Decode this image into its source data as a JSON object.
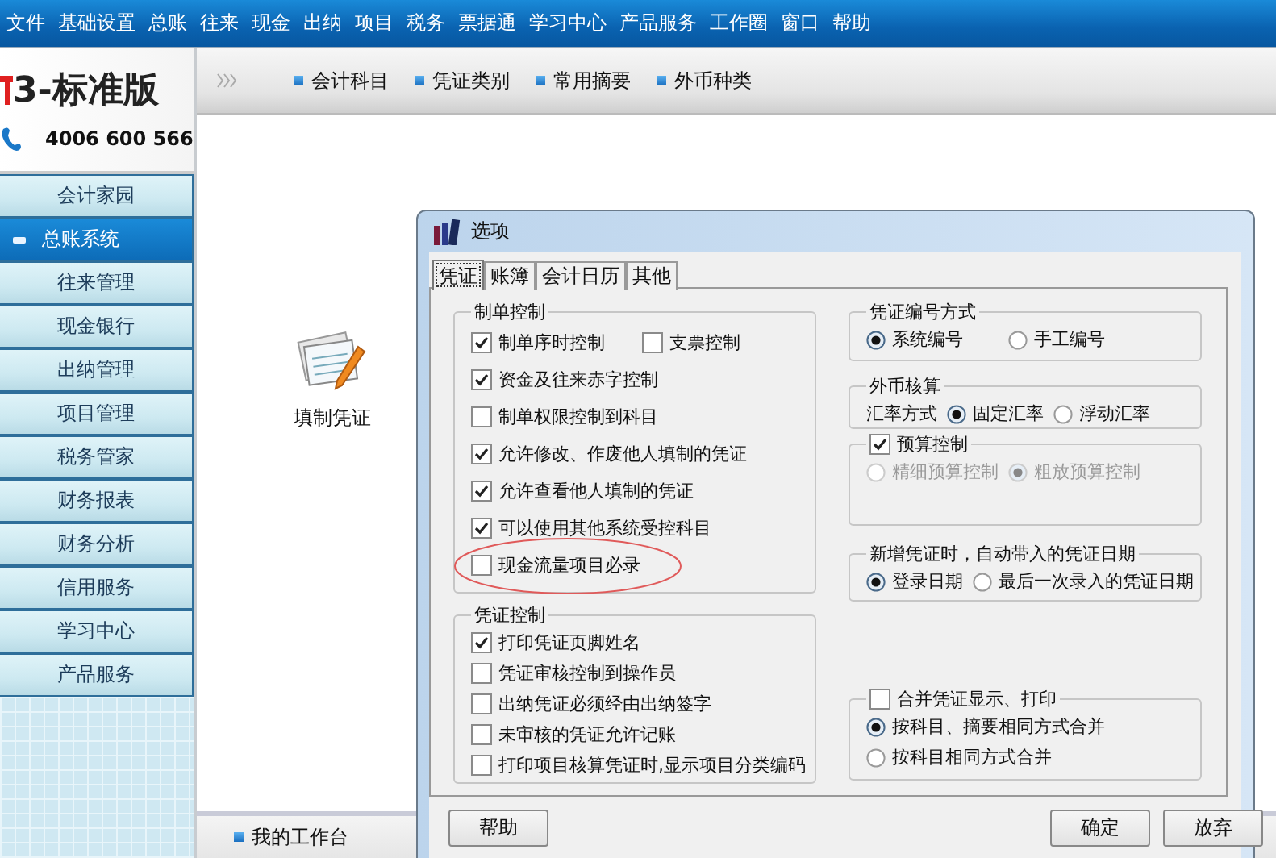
{
  "menu_bar": [
    "文件",
    "基础设置",
    "总账",
    "往来",
    "现金",
    "出纳",
    "项目",
    "税务",
    "票据通",
    "学习中心",
    "产品服务",
    "工作圈",
    "窗口",
    "帮助"
  ],
  "logo": {
    "title": "3-标准版",
    "phone": "4006 600 566"
  },
  "sidebar": {
    "items": [
      {
        "label": "会计家园",
        "selected": false
      },
      {
        "label": "总账系统",
        "selected": true
      },
      {
        "label": "往来管理",
        "selected": false
      },
      {
        "label": "现金银行",
        "selected": false
      },
      {
        "label": "出纳管理",
        "selected": false
      },
      {
        "label": "项目管理",
        "selected": false
      },
      {
        "label": "税务管家",
        "selected": false
      },
      {
        "label": "财务报表",
        "selected": false
      },
      {
        "label": "财务分析",
        "selected": false
      },
      {
        "label": "信用服务",
        "selected": false
      },
      {
        "label": "学习中心",
        "selected": false
      },
      {
        "label": "产品服务",
        "selected": false
      }
    ]
  },
  "toolbar": {
    "links": [
      "会计科目",
      "凭证类别",
      "常用摘要",
      "外币种类"
    ]
  },
  "desktop": {
    "icons": [
      {
        "label": "填制凭证"
      }
    ]
  },
  "bottom_bar": {
    "tabs": [
      "我的工作台"
    ]
  },
  "dialog": {
    "title": "选项",
    "tabs": [
      {
        "label": "凭证",
        "selected": true
      },
      {
        "label": "账簿",
        "selected": false
      },
      {
        "label": "会计日历",
        "selected": false
      },
      {
        "label": "其他",
        "selected": false
      }
    ],
    "left_column": [
      {
        "kind": "plain",
        "title": "制单控制",
        "rows": [
          [
            {
              "kind": "checkbox",
              "label": "制单序时控制",
              "checked": true
            },
            {
              "kind": "checkbox",
              "label": "支票控制",
              "checked": false
            }
          ],
          [
            {
              "kind": "checkbox",
              "label": "资金及往来赤字控制",
              "checked": true
            }
          ],
          [
            {
              "kind": "checkbox",
              "label": "制单权限控制到科目",
              "checked": false
            }
          ],
          [
            {
              "kind": "checkbox",
              "label": "允许修改、作废他人填制的凭证",
              "checked": true
            }
          ],
          [
            {
              "kind": "checkbox",
              "label": "允许查看他人填制的凭证",
              "checked": true
            }
          ],
          [
            {
              "kind": "checkbox",
              "label": "可以使用其他系统受控科目",
              "checked": true
            }
          ],
          [
            {
              "kind": "checkbox",
              "label": "现金流量项目必录",
              "checked": false,
              "circled": true
            }
          ]
        ]
      },
      {
        "kind": "plain",
        "title": "凭证控制",
        "rows": [
          [
            {
              "kind": "checkbox",
              "label": "打印凭证页脚姓名",
              "checked": true
            }
          ],
          [
            {
              "kind": "checkbox",
              "label": "凭证审核控制到操作员",
              "checked": false
            }
          ],
          [
            {
              "kind": "checkbox",
              "label": "出纳凭证必须经由出纳签字",
              "checked": false
            }
          ],
          [
            {
              "kind": "checkbox",
              "label": "未审核的凭证允许记账",
              "checked": false
            }
          ],
          [
            {
              "kind": "checkbox",
              "label": "打印项目核算凭证时,显示项目分类编码",
              "checked": false
            }
          ]
        ]
      }
    ],
    "right_column": [
      {
        "kind": "plain",
        "title": "凭证编号方式",
        "rows": [
          [
            {
              "kind": "radio",
              "label": "系统编号",
              "selected": true
            },
            {
              "kind": "radio",
              "label": "手工编号",
              "selected": false
            }
          ]
        ]
      },
      {
        "kind": "plain",
        "title": "外币核算",
        "rows": [
          [
            {
              "kind": "label",
              "label": "汇率方式"
            },
            {
              "kind": "radio",
              "label": "固定汇率",
              "selected": true
            },
            {
              "kind": "radio",
              "label": "浮动汇率",
              "selected": false
            }
          ]
        ]
      },
      {
        "kind": "checkbox",
        "title": "预算控制",
        "checked": true,
        "rows": [
          [
            {
              "kind": "radio",
              "label": "精细预算控制",
              "selected": false,
              "disabled": true
            },
            {
              "kind": "radio",
              "label": "粗放预算控制",
              "selected": true,
              "disabled": true
            }
          ]
        ]
      },
      {
        "kind": "plain",
        "title": "新增凭证时，自动带入的凭证日期",
        "rows": [
          [
            {
              "kind": "radio",
              "label": "登录日期",
              "selected": true
            },
            {
              "kind": "radio",
              "label": "最后一次录入的凭证日期",
              "selected": false
            }
          ]
        ]
      },
      {
        "kind": "checkbox",
        "title": "合并凭证显示、打印",
        "checked": false,
        "rows": [
          [
            {
              "kind": "radio",
              "label": "按科目、摘要相同方式合并",
              "selected": true
            }
          ],
          [
            {
              "kind": "radio",
              "label": "按科目相同方式合并",
              "selected": false
            }
          ]
        ]
      }
    ],
    "buttons": [
      "帮助",
      "确定",
      "放弃"
    ]
  }
}
